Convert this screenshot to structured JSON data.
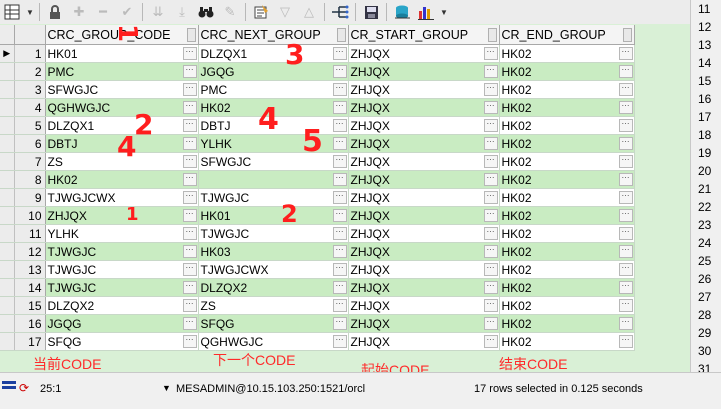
{
  "grid": {
    "columns": [
      "CRC_GROUP_CODE",
      "CRC_NEXT_GROUP",
      "CR_START_GROUP",
      "CR_END_GROUP"
    ],
    "rows": [
      {
        "num": "1",
        "cells": [
          "HK01",
          "DLZQX1",
          "ZHJQX",
          "HK02"
        ]
      },
      {
        "num": "2",
        "cells": [
          "PMC",
          "JGQG",
          "ZHJQX",
          "HK02"
        ]
      },
      {
        "num": "3",
        "cells": [
          "SFWGJC",
          "PMC",
          "ZHJQX",
          "HK02"
        ]
      },
      {
        "num": "4",
        "cells": [
          "QGHWGJC",
          "HK02",
          "ZHJQX",
          "HK02"
        ]
      },
      {
        "num": "5",
        "cells": [
          "DLZQX1",
          "DBTJ",
          "ZHJQX",
          "HK02"
        ]
      },
      {
        "num": "6",
        "cells": [
          "DBTJ",
          "YLHK",
          "ZHJQX",
          "HK02"
        ]
      },
      {
        "num": "7",
        "cells": [
          "ZS",
          "SFWGJC",
          "ZHJQX",
          "HK02"
        ]
      },
      {
        "num": "8",
        "cells": [
          "HK02",
          "",
          "ZHJQX",
          "HK02"
        ]
      },
      {
        "num": "9",
        "cells": [
          "TJWGJCWX",
          "TJWGJC",
          "ZHJQX",
          "HK02"
        ]
      },
      {
        "num": "10",
        "cells": [
          "ZHJQX",
          "HK01",
          "ZHJQX",
          "HK02"
        ]
      },
      {
        "num": "11",
        "cells": [
          "YLHK",
          "TJWGJC",
          "ZHJQX",
          "HK02"
        ]
      },
      {
        "num": "12",
        "cells": [
          "TJWGJC",
          "HK03",
          "ZHJQX",
          "HK02"
        ]
      },
      {
        "num": "13",
        "cells": [
          "TJWGJC",
          "TJWGJCWX",
          "ZHJQX",
          "HK02"
        ]
      },
      {
        "num": "14",
        "cells": [
          "TJWGJC",
          "DLZQX2",
          "ZHJQX",
          "HK02"
        ]
      },
      {
        "num": "15",
        "cells": [
          "DLZQX2",
          "ZS",
          "ZHJQX",
          "HK02"
        ]
      },
      {
        "num": "16",
        "cells": [
          "JGQG",
          "SFQG",
          "ZHJQX",
          "HK02"
        ]
      },
      {
        "num": "17",
        "cells": [
          "SFQG",
          "QGHWGJC",
          "ZHJQX",
          "HK02"
        ]
      }
    ]
  },
  "captions": [
    "当前CODE",
    "下一个CODE",
    "起始CODE",
    "结束CODE"
  ],
  "marks": [
    "1",
    "3",
    "2",
    "4",
    "5",
    "2",
    "1"
  ],
  "right_numbers": [
    "11",
    "12",
    "13",
    "14",
    "15",
    "16",
    "17",
    "18",
    "19",
    "20",
    "21",
    "22",
    "23",
    "24",
    "25",
    "26",
    "27",
    "28",
    "29",
    "30",
    "31"
  ],
  "status": {
    "position": "25:1",
    "connection": "MESADMIN@10.15.103.250:1521/orcl",
    "message": "17 rows selected in 0.125 seconds"
  },
  "colors": {
    "even_row": "#c9ecc2",
    "annotation": "#ff2a2a"
  }
}
